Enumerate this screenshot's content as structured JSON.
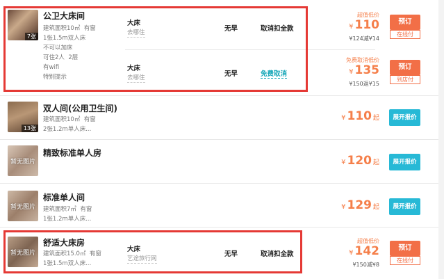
{
  "rooms": [
    {
      "name": "公卫大床间",
      "photo_count": "7张",
      "info": [
        "建筑面积10㎡",
        "有窗",
        "1张1.5m双人床",
        "不可以加床",
        "可住2人",
        "2层",
        "有wifi",
        "特别提示"
      ],
      "offers": [
        {
          "bed": "大床",
          "source": "去哪住",
          "breakfast": "无早",
          "cancel": "取消扣全款",
          "tag": "超值低价",
          "currency": "¥",
          "price": "110",
          "sub": "¥124减¥14",
          "book": "预订",
          "pay": "在线付"
        },
        {
          "bed": "大床",
          "source": "去哪住",
          "breakfast": "无早",
          "cancel": "免费取消",
          "tag": "免费取消低价",
          "currency": "¥",
          "price": "135",
          "sub": "¥150返¥15",
          "book": "预订",
          "pay": "到店付"
        }
      ]
    },
    {
      "name": "双人间(公用卫生间)",
      "photo_count": "13张",
      "info": [
        "建筑面积10㎡",
        "有窗",
        "2张1.2m单人床..."
      ],
      "currency": "¥",
      "price": "110",
      "qi": "起",
      "button": "展开报价"
    },
    {
      "name": "精致标准单人房",
      "photo_label": "暂无图片",
      "currency": "¥",
      "price": "120",
      "qi": "起",
      "button": "展开报价"
    },
    {
      "name": "标准单人间",
      "photo_label": "暂无图片",
      "info": [
        "建筑面积7㎡",
        "有窗",
        "1张1.2m单人床..."
      ],
      "currency": "¥",
      "price": "129",
      "qi": "起",
      "button": "展开报价"
    },
    {
      "name": "舒适大床房",
      "photo_label": "暂无图片",
      "info": [
        "建筑面积15.0㎡",
        "有窗",
        "1张1.5m双人床..."
      ],
      "offer": {
        "bed": "大床",
        "source": "艺途旅行网",
        "breakfast": "无早",
        "cancel": "取消扣全款",
        "tag": "超值低价",
        "currency": "¥",
        "price": "142",
        "sub": "¥150减¥8",
        "book": "预订",
        "pay": "在线付"
      }
    }
  ],
  "colors": {
    "price": "#f57f4a",
    "book_button": "#f26f47",
    "show_button": "#27b9d6",
    "highlight": "#e53935",
    "free_cancel": "#1ba9ba"
  }
}
